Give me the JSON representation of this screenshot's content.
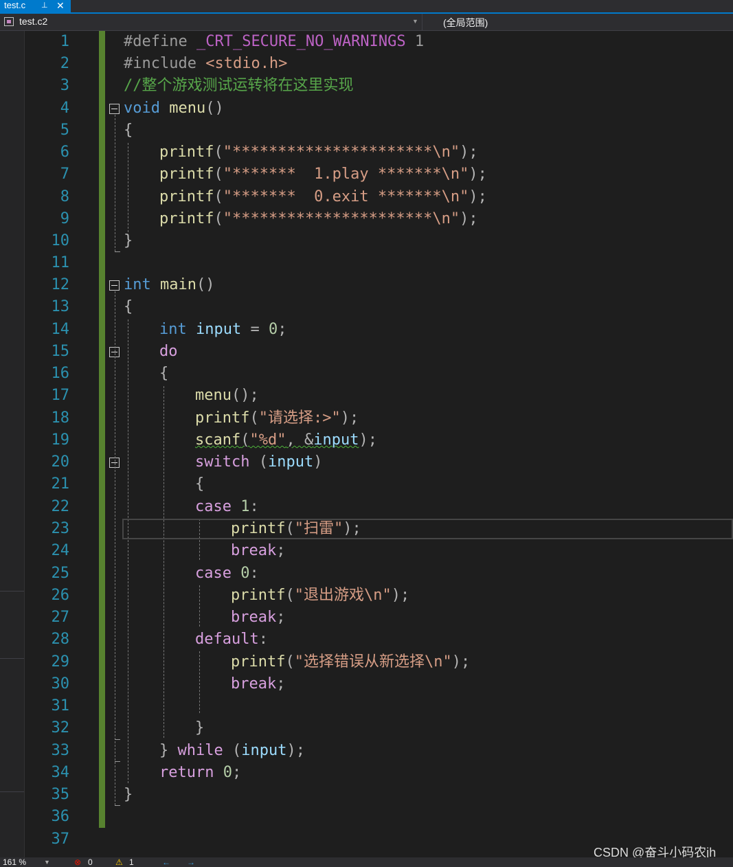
{
  "tab": {
    "title": "test.c",
    "pin": "⊥",
    "close": "✕"
  },
  "nav": {
    "project": "test.c2",
    "scope": "(全局范围)"
  },
  "line_numbers": [
    "1",
    "2",
    "3",
    "4",
    "5",
    "6",
    "7",
    "8",
    "9",
    "10",
    "11",
    "12",
    "13",
    "14",
    "15",
    "16",
    "17",
    "18",
    "19",
    "20",
    "21",
    "22",
    "23",
    "24",
    "25",
    "26",
    "27",
    "28",
    "29",
    "30",
    "31",
    "32",
    "33",
    "34",
    "35",
    "36",
    "37"
  ],
  "code": {
    "l1": {
      "a": "#define ",
      "b": "_CRT_SECURE_NO_WARNINGS",
      "c": " 1"
    },
    "l2": {
      "a": "#include ",
      "b": "<stdio.h>"
    },
    "l3": {
      "a": "//整个游戏测试运转将在这里实现"
    },
    "l4": {
      "a": "void",
      "b": " menu",
      "c": "()"
    },
    "l5": {
      "a": "{"
    },
    "l6": {
      "a": "printf",
      "b": "(",
      "c": "\"**********************\\n\"",
      "d": ");"
    },
    "l7": {
      "a": "printf",
      "b": "(",
      "c": "\"*******  1.play *******\\n\"",
      "d": ");"
    },
    "l8": {
      "a": "printf",
      "b": "(",
      "c": "\"*******  0.exit *******\\n\"",
      "d": ");"
    },
    "l9": {
      "a": "printf",
      "b": "(",
      "c": "\"**********************\\n\"",
      "d": ");"
    },
    "l10": {
      "a": "}"
    },
    "l12": {
      "a": "int",
      "b": " main",
      "c": "()"
    },
    "l13": {
      "a": "{"
    },
    "l14": {
      "a": "int",
      "b": " input",
      "c": " = ",
      "d": "0",
      "e": ";"
    },
    "l15": {
      "a": "do"
    },
    "l16": {
      "a": "{"
    },
    "l17": {
      "a": "menu",
      "b": "();"
    },
    "l18": {
      "a": "printf",
      "b": "(",
      "c": "\"请选择:>\"",
      "d": ");"
    },
    "l19": {
      "a": "scanf",
      "b": "(",
      "c": "\"%d\"",
      "d": ", &",
      "e": "input",
      "f": ");"
    },
    "l20": {
      "a": "switch",
      "b": " (",
      "c": "input",
      "d": ")"
    },
    "l21": {
      "a": "{"
    },
    "l22": {
      "a": "case",
      "b": " 1",
      "c": ":"
    },
    "l23": {
      "a": "printf",
      "b": "(",
      "c": "\"扫雷\"",
      "d": ");"
    },
    "l24": {
      "a": "break",
      "b": ";"
    },
    "l25": {
      "a": "case",
      "b": " 0",
      "c": ":"
    },
    "l26": {
      "a": "printf",
      "b": "(",
      "c": "\"退出游戏\\n\"",
      "d": ");"
    },
    "l27": {
      "a": "break",
      "b": ";"
    },
    "l28": {
      "a": "default",
      "b": ":"
    },
    "l29": {
      "a": "printf",
      "b": "(",
      "c": "\"选择错误从新选择\\n\"",
      "d": ");"
    },
    "l30": {
      "a": "break",
      "b": ";"
    },
    "l32": {
      "a": "}"
    },
    "l33": {
      "a": "} ",
      "b": "while",
      "c": " (",
      "d": "input",
      "e": ");"
    },
    "l34": {
      "a": "return",
      "b": " 0",
      "c": ";"
    },
    "l35": {
      "a": "}"
    }
  },
  "status": {
    "zoom": "161 %",
    "errors": "0",
    "warnings": "1",
    "back_arrow": "←",
    "forward_arrow": "→"
  },
  "watermark": "CSDN @奋斗小码农jh",
  "colors": {
    "accent": "#007acc",
    "change_bar": "#57822f",
    "keyword": "#569cd6",
    "control": "#d8a0df",
    "function": "#dcdcaa",
    "string": "#d69d85",
    "comment": "#57a64a"
  }
}
